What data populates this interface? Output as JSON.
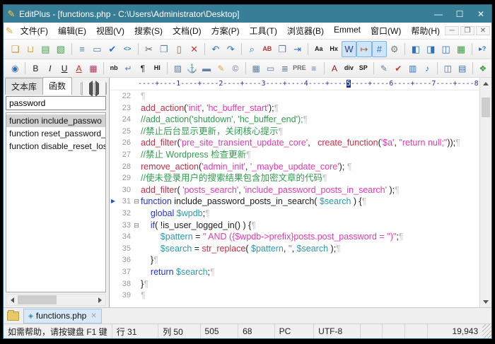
{
  "colors": {
    "title_bar": "#377E96",
    "toolbar_active_bg": "#CDE6F7",
    "plain": "#1A1A1A",
    "function": "#CB2E44",
    "string": "#E43BB0",
    "keyword": "#2233DD",
    "variable": "#2E9BAB",
    "comment": "#2F9E4E",
    "pilcrow": "#C4C4C4",
    "line_number": "#9A9A9A",
    "ruler": "#2F2F9E"
  },
  "window": {
    "title": "EditPlus - [functions.php - C:\\Users\\Administrator\\Desktop]",
    "minimize": "—",
    "maximize": "☐",
    "close": "✕"
  },
  "menu": {
    "items": [
      "文件(F)",
      "编辑(E)",
      "视图(V)",
      "搜索(S)",
      "文档(D)",
      "方案(P)",
      "工具(T)",
      "浏览器(B)",
      "Emmet",
      "窗口(W)",
      "帮助(H)"
    ],
    "mdi_controls": [
      "─",
      "❐",
      "✕"
    ]
  },
  "toolbar_main": {
    "groups": [
      [
        {
          "name": "new-file",
          "glyph": "❏",
          "color": "#C98A2B"
        },
        {
          "name": "open-folder",
          "glyph": "⊔",
          "color": "#D9A93C"
        },
        {
          "name": "save",
          "glyph": "▤",
          "color": "#3FA047"
        },
        {
          "name": "save-all",
          "glyph": "▧",
          "color": "#3FA047"
        }
      ],
      [
        {
          "name": "print-preview",
          "glyph": "≡",
          "color": "#5B7FA6"
        },
        {
          "name": "print",
          "glyph": "▭",
          "color": "#5B7FA6"
        },
        {
          "name": "spell-check",
          "glyph": "✔",
          "color": "#2E6FBF"
        },
        {
          "name": "html-code",
          "glyph": "<>",
          "color": "#2E86A8",
          "small": true
        }
      ],
      [
        {
          "name": "cut",
          "glyph": "✂",
          "color": "#606060"
        },
        {
          "name": "copy",
          "glyph": "❐",
          "color": "#5B7FA6"
        },
        {
          "name": "paste",
          "glyph": "▯",
          "color": "#8A6D3B"
        },
        {
          "name": "delete",
          "glyph": "✕",
          "color": "#CC3333"
        }
      ],
      [
        {
          "name": "undo",
          "glyph": "↶",
          "color": "#2E6FBF"
        },
        {
          "name": "redo",
          "glyph": "↷",
          "color": "#2E6FBF"
        }
      ],
      [
        {
          "name": "find",
          "glyph": "⌕",
          "color": "#2E6FBF"
        },
        {
          "name": "find-in-files",
          "glyph": "AB",
          "color": "#B03030",
          "small": true
        },
        {
          "name": "new-from-template",
          "glyph": "❒",
          "color": "#5B7FA6"
        },
        {
          "name": "goto-line",
          "glyph": "⇥",
          "color": "#2E6FBF"
        }
      ],
      [
        {
          "name": "change-case",
          "glyph": "Aa",
          "color": "#1A1A1A",
          "small": true
        },
        {
          "name": "hex-view",
          "glyph": "Hx",
          "color": "#1A1A1A",
          "small": true
        },
        {
          "name": "word-wrap",
          "glyph": "W",
          "color": "#3A3A8C",
          "active": true
        },
        {
          "name": "wrap-marker",
          "glyph": "↦",
          "color": "#B05A2A",
          "active": true
        },
        {
          "name": "line-numbers",
          "glyph": "#",
          "color": "#2E6FBF",
          "active": true
        },
        {
          "name": "settings",
          "glyph": "⚙",
          "color": "#7A7A7A"
        }
      ],
      [
        {
          "name": "toggle-sidebar",
          "glyph": "◧",
          "color": "#2E6FBF"
        },
        {
          "name": "toggle-output",
          "glyph": "◨",
          "color": "#2E6FBF"
        },
        {
          "name": "toggle-cliptext",
          "glyph": "◫",
          "color": "#2E6FBF"
        },
        {
          "name": "toggle-browser",
          "glyph": "▦",
          "color": "#3FA047"
        }
      ],
      [
        {
          "name": "context-help",
          "glyph": "▸?",
          "color": "#2E6FBF",
          "small": true
        }
      ]
    ]
  },
  "toolbar_html": {
    "groups": [
      [
        {
          "name": "browser-preview",
          "glyph": "◉",
          "color": "#2E6FBF"
        }
      ],
      [
        {
          "name": "bold",
          "glyph": "B",
          "color": "#1A1A1A"
        },
        {
          "name": "italic",
          "glyph": "I",
          "color": "#1A1A1A"
        },
        {
          "name": "underline",
          "glyph": "U",
          "color": "#1A1A1A"
        },
        {
          "name": "font-color",
          "glyph": "A",
          "color": "#D03020"
        },
        {
          "name": "color-picker",
          "glyph": "▦",
          "color": "#B03060"
        }
      ],
      [
        {
          "name": "nbsp",
          "glyph": "nb",
          "color": "#1A1A1A",
          "small": true
        },
        {
          "name": "line-break",
          "glyph": "↵",
          "color": "#5B7FA6"
        },
        {
          "name": "paragraph",
          "glyph": "¶",
          "color": "#1A1A1A"
        },
        {
          "name": "heading",
          "glyph": "HI",
          "color": "#1A1A1A",
          "small": true
        }
      ],
      [
        {
          "name": "insert-image",
          "glyph": "▨",
          "color": "#5B7FA6"
        },
        {
          "name": "anchor",
          "glyph": "⚓",
          "color": "#C98A2B"
        },
        {
          "name": "horizontal-rule",
          "glyph": "▬",
          "color": "#5B7FA6"
        },
        {
          "name": "edit-tag",
          "glyph": "✎",
          "color": "#D9A93C"
        },
        {
          "name": "special-chars",
          "glyph": "©",
          "color": "#5B7FA6"
        }
      ],
      [
        {
          "name": "table",
          "glyph": "▦",
          "color": "#5B7FA6"
        },
        {
          "name": "textarea",
          "glyph": "▭",
          "color": "#5B7FA6"
        },
        {
          "name": "align-text",
          "glyph": "≣",
          "color": "#5B7FA6"
        },
        {
          "name": "pre-tag",
          "glyph": "PRE",
          "color": "#707070",
          "small": true
        },
        {
          "name": "list-tag",
          "glyph": "≡",
          "color": "#5B7FA6"
        }
      ],
      [
        {
          "name": "font-tag",
          "glyph": "A",
          "color": "#8C1A1A"
        },
        {
          "name": "div-tag",
          "glyph": "div",
          "color": "#1A1A1A",
          "small": true
        },
        {
          "name": "span-tag",
          "glyph": "SP",
          "color": "#1A1A1A",
          "small": true
        }
      ],
      [
        {
          "name": "edit-script",
          "glyph": "✎",
          "color": "#5B7FA6"
        },
        {
          "name": "syntax-check",
          "glyph": "✔",
          "color": "#C23B3B"
        },
        {
          "name": "insert-media",
          "glyph": "▥",
          "color": "#2E6FBF"
        },
        {
          "name": "insert-music",
          "glyph": "♪",
          "color": "#2E6FBF"
        }
      ],
      [
        {
          "name": "toggle-panel-a",
          "glyph": "◫",
          "color": "#2E6FBF"
        },
        {
          "name": "toggle-panel-b",
          "glyph": "▤",
          "color": "#2E6FBF"
        }
      ],
      [
        {
          "name": "color-palette",
          "glyph": "❖",
          "color": "#3FA047"
        }
      ]
    ]
  },
  "sidebar": {
    "tabs": [
      {
        "label": "文本库",
        "active": false
      },
      {
        "label": "函数",
        "active": true
      }
    ],
    "search_value": "password",
    "functions": [
      {
        "label": "function include_passwo",
        "selected": true
      },
      {
        "label": "function reset_password_",
        "selected": false
      },
      {
        "label": "function disable_reset_los",
        "selected": false
      }
    ]
  },
  "ruler": {
    "pre": "----+----1----+----2----+----3----+----4----+----",
    "highlight": "5",
    "post": "----+----6----+----7----+----8----+--"
  },
  "editor": {
    "pilcrow": "¶",
    "fold_glyph": "⊟",
    "marker_glyph": "▶",
    "lines": [
      {
        "num": "22",
        "tokens": []
      },
      {
        "num": "23",
        "tokens": [
          {
            "c": "f",
            "t": "add_action"
          },
          {
            "c": "p",
            "t": "("
          },
          {
            "c": "s",
            "t": "'init'"
          },
          {
            "c": "p",
            "t": ", "
          },
          {
            "c": "s",
            "t": "'hc_buffer_start'"
          },
          {
            "c": "p",
            "t": ");"
          }
        ]
      },
      {
        "num": "24",
        "tokens": [
          {
            "c": "m",
            "t": "//add_action('shutdown', 'hc_buffer_end');"
          }
        ]
      },
      {
        "num": "25",
        "tokens": [
          {
            "c": "m",
            "t": "//禁止后台显示更新，关闭核心提示"
          }
        ]
      },
      {
        "num": "26",
        "tokens": [
          {
            "c": "f",
            "t": "add_filter"
          },
          {
            "c": "p",
            "t": "("
          },
          {
            "c": "s",
            "t": "'pre_site_transient_update_core'"
          },
          {
            "c": "p",
            "t": ",   "
          },
          {
            "c": "f",
            "t": "create_function"
          },
          {
            "c": "p",
            "t": "("
          },
          {
            "c": "s",
            "t": "'$a'"
          },
          {
            "c": "p",
            "t": ", "
          },
          {
            "c": "s",
            "t": "\"return null;\""
          },
          {
            "c": "p",
            "t": "));"
          }
        ]
      },
      {
        "num": "27",
        "tokens": [
          {
            "c": "m",
            "t": "//禁止 Wordpress 检查更新"
          }
        ]
      },
      {
        "num": "28",
        "tokens": [
          {
            "c": "f",
            "t": "remove_action"
          },
          {
            "c": "p",
            "t": "("
          },
          {
            "c": "s",
            "t": "'admin_init'"
          },
          {
            "c": "p",
            "t": ", "
          },
          {
            "c": "s",
            "t": "'_maybe_update_core'"
          },
          {
            "c": "p",
            "t": "); "
          }
        ]
      },
      {
        "num": "29",
        "tokens": [
          {
            "c": "m",
            "t": "//使未登录用户的搜索结果包含加密文章的代码"
          }
        ]
      },
      {
        "num": "30",
        "tokens": [
          {
            "c": "f",
            "t": "add_filter"
          },
          {
            "c": "p",
            "t": "( "
          },
          {
            "c": "s",
            "t": "'posts_search'"
          },
          {
            "c": "p",
            "t": ", "
          },
          {
            "c": "s",
            "t": "'include_password_posts_in_search'"
          },
          {
            "c": "p",
            "t": " );"
          }
        ]
      },
      {
        "num": "31",
        "marker": true,
        "fold": true,
        "tokens": [
          {
            "c": "k",
            "t": "function"
          },
          {
            "c": "p",
            "t": " include_password_posts_in_search( "
          },
          {
            "c": "v",
            "t": "$search"
          },
          {
            "c": "p",
            "t": " ) {"
          }
        ]
      },
      {
        "num": "32",
        "tokens": [
          {
            "c": "p",
            "t": "    "
          },
          {
            "c": "k",
            "t": "global"
          },
          {
            "c": "p",
            "t": " "
          },
          {
            "c": "v",
            "t": "$wpdb"
          },
          {
            "c": "p",
            "t": ";"
          }
        ]
      },
      {
        "num": "33",
        "fold": true,
        "tokens": [
          {
            "c": "p",
            "t": "    "
          },
          {
            "c": "k",
            "t": "if"
          },
          {
            "c": "p",
            "t": "( !is_user_logged_in() ) {"
          }
        ]
      },
      {
        "num": "34",
        "tokens": [
          {
            "c": "p",
            "t": "        "
          },
          {
            "c": "v",
            "t": "$pattern"
          },
          {
            "c": "p",
            "t": " = "
          },
          {
            "c": "s",
            "t": "\" AND ({$wpdb->prefix}posts.post_password = '')\""
          },
          {
            "c": "p",
            "t": ";"
          }
        ]
      },
      {
        "num": "35",
        "tokens": [
          {
            "c": "p",
            "t": "        "
          },
          {
            "c": "v",
            "t": "$search"
          },
          {
            "c": "p",
            "t": " = "
          },
          {
            "c": "f",
            "t": "str_replace"
          },
          {
            "c": "p",
            "t": "( "
          },
          {
            "c": "v",
            "t": "$pattern"
          },
          {
            "c": "p",
            "t": ", "
          },
          {
            "c": "s",
            "t": "''"
          },
          {
            "c": "p",
            "t": ", "
          },
          {
            "c": "v",
            "t": "$search"
          },
          {
            "c": "p",
            "t": " );"
          }
        ]
      },
      {
        "num": "36",
        "tokens": [
          {
            "c": "p",
            "t": "    }"
          }
        ]
      },
      {
        "num": "37",
        "tokens": [
          {
            "c": "p",
            "t": "    "
          },
          {
            "c": "k",
            "t": "return"
          },
          {
            "c": "p",
            "t": " "
          },
          {
            "c": "v",
            "t": "$search"
          },
          {
            "c": "p",
            "t": ";"
          }
        ]
      },
      {
        "num": "38",
        "tokens": [
          {
            "c": "p",
            "t": "}"
          }
        ]
      },
      {
        "num": "39",
        "tokens": []
      }
    ]
  },
  "doc_tabs": {
    "tabs": [
      {
        "label": "functions.php",
        "active": true,
        "diamond": "◈",
        "close": "✕"
      }
    ]
  },
  "status_bar": {
    "segments": [
      "如需帮助，请按键盘 F1 键",
      "行 31",
      "列 50",
      "505",
      "68",
      "PC",
      "UTF-8",
      "",
      "",
      "",
      "19,943"
    ]
  }
}
